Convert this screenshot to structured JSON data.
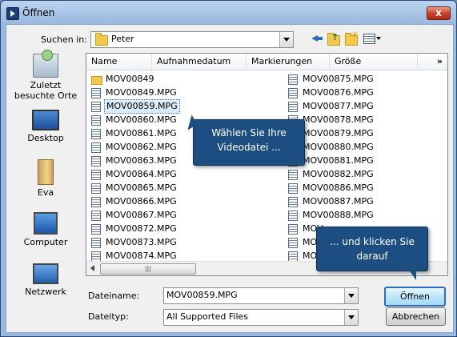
{
  "window": {
    "title": "Öffnen",
    "close_label": "x"
  },
  "toolbar": {
    "lookin_label": "Suchen in:",
    "lookin_value": "Peter"
  },
  "places": [
    {
      "label": "Zuletzt besuchte Orte",
      "icon": "recent-places-icon"
    },
    {
      "label": "Desktop",
      "icon": "desktop-icon"
    },
    {
      "label": "Eva",
      "icon": "user-folder-icon"
    },
    {
      "label": "Computer",
      "icon": "computer-icon"
    },
    {
      "label": "Netzwerk",
      "icon": "network-icon"
    }
  ],
  "columns": [
    "Name",
    "Aufnahmedatum",
    "Markierungen",
    "Größe"
  ],
  "more_columns": "»",
  "files_left": [
    "MOV00849",
    "MOV00849.MPG",
    "MOV00859.MPG",
    "MOV00860.MPG",
    "MOV00861.MPG",
    "MOV00862.MPG",
    "MOV00863.MPG",
    "MOV00864.MPG",
    "MOV00865.MPG",
    "MOV00866.MPG",
    "MOV00867.MPG",
    "MOV00872.MPG",
    "MOV00873.MPG",
    "MOV00874.MPG"
  ],
  "files_right": [
    "MOV00875.MPG",
    "MOV00876.MPG",
    "MOV00877.MPG",
    "MOV00878.MPG",
    "MOV00879.MPG",
    "MOV00880.MPG",
    "MOV00881.MPG",
    "MOV00882.MPG",
    "MOV00886.MPG",
    "MOV00887.MPG",
    "MOV00888.MPG",
    "MOV",
    "MOV",
    "MOV"
  ],
  "selected_file": "MOV00859.MPG",
  "filename": {
    "label": "Dateiname:",
    "value": "MOV00859.MPG"
  },
  "filetype": {
    "label": "Dateityp:",
    "value": "All Supported Files"
  },
  "buttons": {
    "open": "Öffnen",
    "cancel": "Abbrechen"
  },
  "callouts": {
    "first": "Wählen Sie Ihre Videodatei ...",
    "second": "... und klicken Sie darauf"
  },
  "colors": {
    "callout_bg": "#1d4e82",
    "selection": "#dceaf9",
    "title_gradient": "#9ab9e0"
  }
}
